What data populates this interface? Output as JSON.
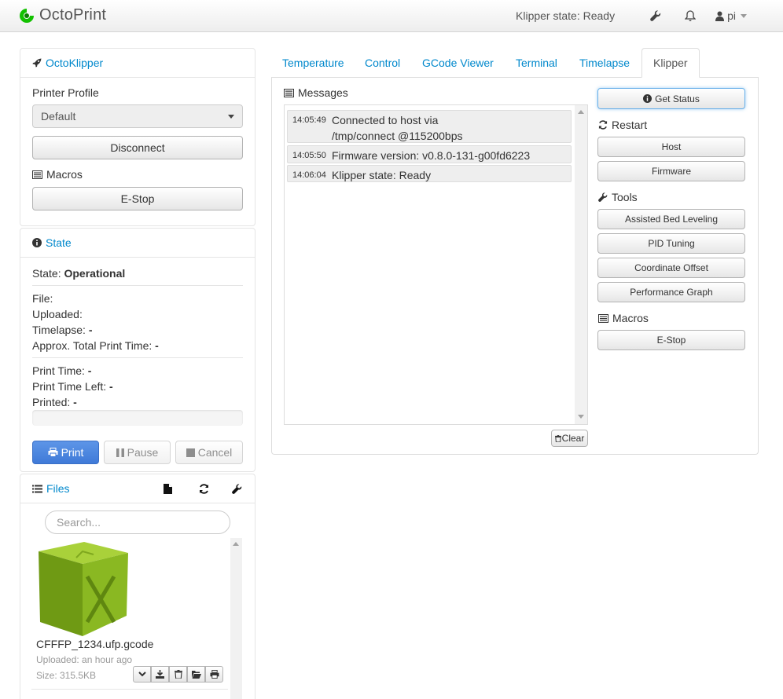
{
  "navbar": {
    "brand": "OctoPrint",
    "klipper_state": "Klipper state: Ready",
    "user": "pi"
  },
  "octoklipper": {
    "title": "OctoKlipper",
    "printer_profile_label": "Printer Profile",
    "printer_profile_value": "Default",
    "disconnect_label": "Disconnect",
    "macros_label": "Macros",
    "estop_label": "E-Stop"
  },
  "state": {
    "title": "State",
    "state_label": "State:",
    "state_value": "Operational",
    "file_label": "File:",
    "uploaded_label": "Uploaded:",
    "timelapse_label": "Timelapse:",
    "timelapse_value": "-",
    "approx_label": "Approx. Total Print Time:",
    "approx_value": "-",
    "print_time_label": "Print Time:",
    "print_time_value": "-",
    "print_time_left_label": "Print Time Left:",
    "print_time_left_value": "-",
    "printed_label": "Printed:",
    "printed_value": "-",
    "progress": 0,
    "print_label": "Print",
    "pause_label": "Pause",
    "cancel_label": "Cancel"
  },
  "files": {
    "title": "Files",
    "search_placeholder": "Search...",
    "items": [
      {
        "name": "CFFFP_1234.ufp.gcode",
        "uploaded": "Uploaded: an hour ago",
        "size": "Size: 315.5KB"
      }
    ]
  },
  "tabs": [
    {
      "label": "Temperature"
    },
    {
      "label": "Control"
    },
    {
      "label": "GCode Viewer"
    },
    {
      "label": "Terminal"
    },
    {
      "label": "Timelapse"
    },
    {
      "label": "Klipper"
    }
  ],
  "klipper_panel": {
    "messages_title": "Messages",
    "messages": [
      {
        "time": "14:05:49",
        "text": "Connected to host via /tmp/connect @115200bps"
      },
      {
        "time": "14:05:50",
        "text": "Firmware version: v0.8.0-131-g00fd6223"
      },
      {
        "time": "14:06:04",
        "text": "Klipper state: Ready"
      }
    ],
    "clear_label": "Clear",
    "get_status_label": "Get Status",
    "restart_title": "Restart",
    "host_label": "Host",
    "firmware_label": "Firmware",
    "tools_title": "Tools",
    "assisted_bed_leveling_label": "Assisted Bed Leveling",
    "pid_tuning_label": "PID Tuning",
    "coordinate_offset_label": "Coordinate Offset",
    "performance_graph_label": "Performance Graph",
    "macros_title": "Macros",
    "estop_label": "E-Stop"
  },
  "colors": {
    "link": "#0088cc",
    "primary_button": "#428bca",
    "brand_green": "#13c100"
  },
  "icons": [
    "octoprint-logo-icon",
    "wrench-icon",
    "bell-icon",
    "user-icon",
    "rocket-icon",
    "list-icon",
    "info-circle-icon",
    "print-icon",
    "pause-icon",
    "stop-icon",
    "file-icon",
    "refresh-icon",
    "chevron-down-icon",
    "download-icon",
    "trash-icon",
    "folder-open-icon"
  ]
}
